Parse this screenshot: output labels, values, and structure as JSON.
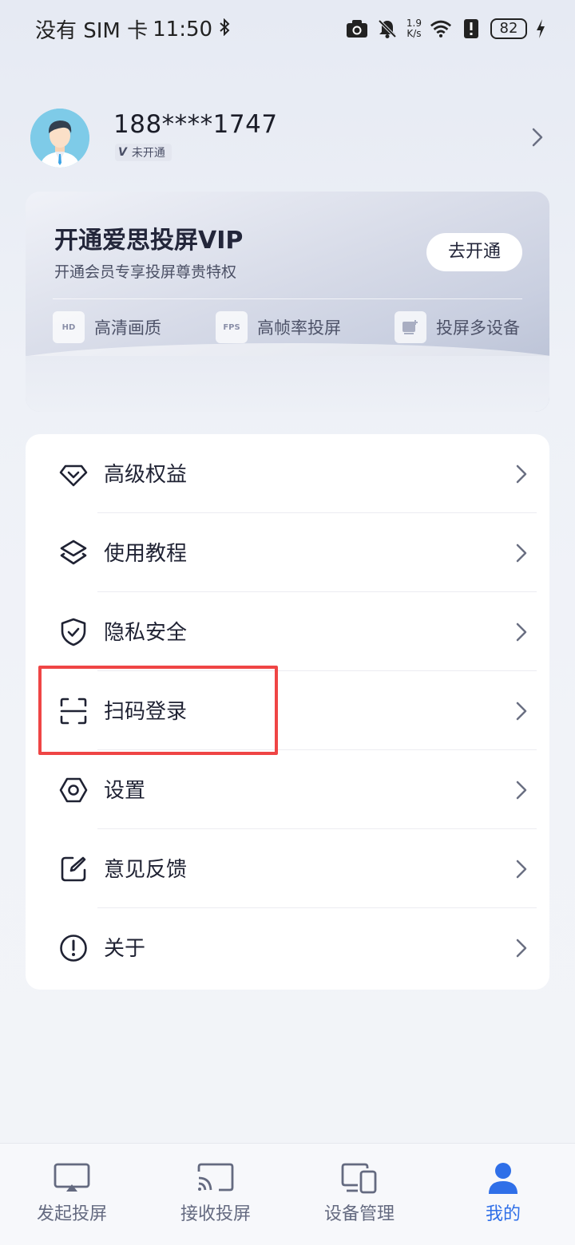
{
  "status_bar": {
    "carrier": "没有 SIM 卡",
    "time": "11:50",
    "net_speed_value": "1.9",
    "net_speed_unit": "K/s",
    "battery": "82",
    "icons": [
      "bluetooth-icon",
      "camera-icon",
      "mute-bell-icon",
      "wifi-icon",
      "alert-icon",
      "charging-icon"
    ]
  },
  "profile": {
    "phone": "188****1747",
    "vip_badge_letter": "V",
    "vip_status": "未开通"
  },
  "vip_card": {
    "title": "开通爱思投屏VIP",
    "subtitle": "开通会员专享投屏尊贵特权",
    "button": "去开通",
    "perks": [
      {
        "icon_text": "HD",
        "label": "高清画质"
      },
      {
        "icon_text": "FPS",
        "label": "高帧率投屏"
      },
      {
        "icon": "multi-device-icon",
        "label": "投屏多设备"
      }
    ]
  },
  "menu": {
    "items": [
      {
        "icon": "diamond-icon",
        "label": "高级权益"
      },
      {
        "icon": "layers-icon",
        "label": "使用教程"
      },
      {
        "icon": "shield-check-icon",
        "label": "隐私安全"
      },
      {
        "icon": "scan-icon",
        "label": "扫码登录"
      },
      {
        "icon": "hexagon-settings-icon",
        "label": "设置"
      },
      {
        "icon": "edit-icon",
        "label": "意见反馈"
      },
      {
        "icon": "info-icon",
        "label": "关于"
      }
    ]
  },
  "tabs": [
    {
      "icon": "cast-send-icon",
      "label": "发起投屏"
    },
    {
      "icon": "cast-receive-icon",
      "label": "接收投屏"
    },
    {
      "icon": "devices-icon",
      "label": "设备管理"
    },
    {
      "icon": "user-icon",
      "label": "我的",
      "active": true
    }
  ],
  "colors": {
    "accent": "#2f6fe8",
    "highlight": "#ef4545",
    "text_primary": "#1f2233",
    "tab_inactive": "#646a80"
  }
}
